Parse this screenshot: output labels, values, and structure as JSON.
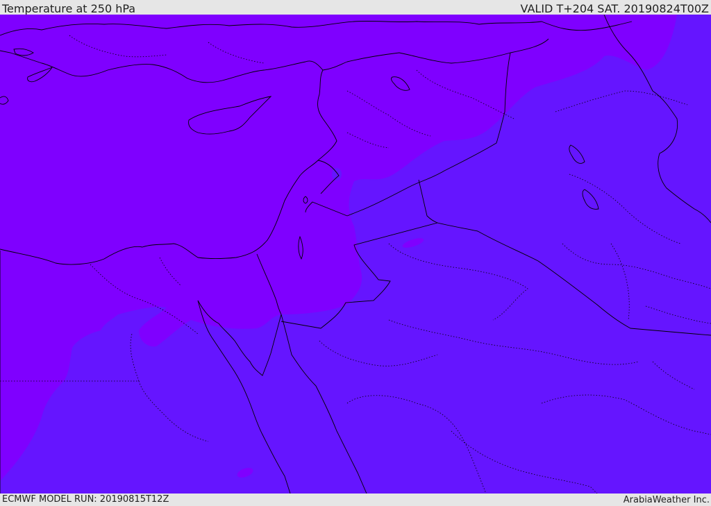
{
  "header": {
    "title": "Temperature at 250 hPa",
    "valid": "VALID T+204 SAT. 20190824T00Z"
  },
  "footer": {
    "model_run": "ECMWF MODEL RUN: 20190815T12Z",
    "credit": "ArabiaWeather Inc."
  },
  "map": {
    "colors": {
      "warm_band": "#7f00ff",
      "cool_band": "#6515ff",
      "lines": "#000000"
    }
  }
}
